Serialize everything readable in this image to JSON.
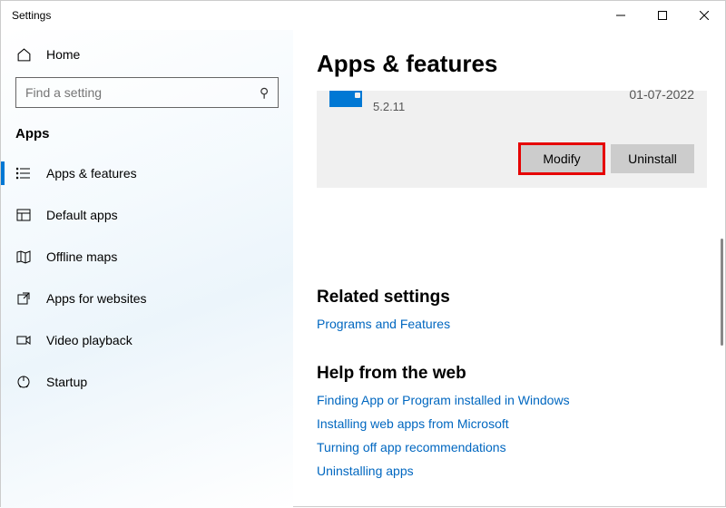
{
  "titlebar": {
    "title": "Settings"
  },
  "sidebar": {
    "home_label": "Home",
    "search_placeholder": "Find a setting",
    "category": "Apps",
    "items": [
      {
        "label": "Apps & features"
      },
      {
        "label": "Default apps"
      },
      {
        "label": "Offline maps"
      },
      {
        "label": "Apps for websites"
      },
      {
        "label": "Video playback"
      },
      {
        "label": "Startup"
      }
    ]
  },
  "main": {
    "heading": "Apps & features",
    "app": {
      "version": "5.2.11",
      "date": "01-07-2022",
      "modify_label": "Modify",
      "uninstall_label": "Uninstall"
    },
    "related": {
      "title": "Related settings",
      "links": [
        "Programs and Features"
      ]
    },
    "help": {
      "title": "Help from the web",
      "links": [
        "Finding App or Program installed in Windows",
        "Installing web apps from Microsoft",
        "Turning off app recommendations",
        "Uninstalling apps"
      ]
    }
  }
}
